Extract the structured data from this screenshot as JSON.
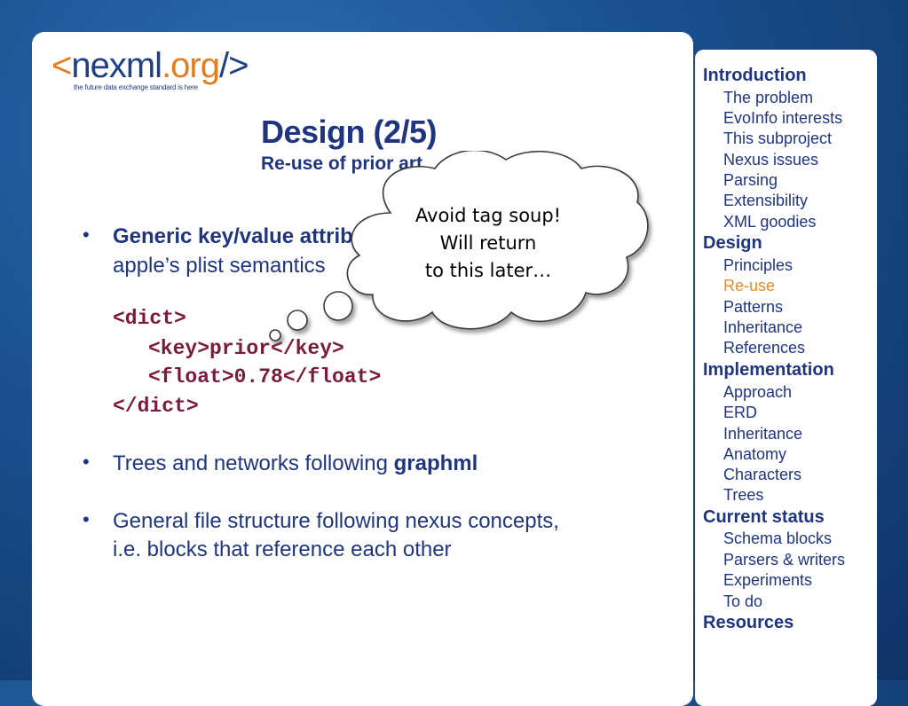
{
  "logo": {
    "open_bracket": "<",
    "name": "nexml",
    "tld": ".org",
    "close_bracket": "/>",
    "tagline": "the future data exchange standard is here"
  },
  "slide": {
    "title": "Design (2/5)",
    "subtitle": "Re-use of prior art"
  },
  "content": {
    "bullet_char": "•",
    "item1": {
      "bold": "Generic key/value attributes",
      "line2": "apple’s plist semantics"
    },
    "code_lines": [
      "<dict>",
      "<key>prior</key>",
      "<float>0.78</float>",
      "</dict>"
    ],
    "item2": {
      "text": "Trees and networks following ",
      "bold": "graphml"
    },
    "item3": {
      "line1": "General file structure following nexus concepts,",
      "line2": "i.e. blocks that reference each other"
    }
  },
  "callout": {
    "lines": [
      "Avoid tag soup!",
      "Will return",
      "to this later…"
    ]
  },
  "sidebar": {
    "active_color": "#e98b22",
    "items": [
      {
        "label": "Introduction",
        "level": "section"
      },
      {
        "label": "The problem",
        "level": "sub"
      },
      {
        "label": "EvoInfo interests",
        "level": "sub"
      },
      {
        "label": "This subproject",
        "level": "sub"
      },
      {
        "label": "Nexus issues",
        "level": "sub"
      },
      {
        "label": "Parsing",
        "level": "sub"
      },
      {
        "label": "Extensibility",
        "level": "sub"
      },
      {
        "label": "XML goodies",
        "level": "sub"
      },
      {
        "label": "Design",
        "level": "section"
      },
      {
        "label": "Principles",
        "level": "sub"
      },
      {
        "label": "Re-use",
        "level": "sub",
        "active": true
      },
      {
        "label": "Patterns",
        "level": "sub"
      },
      {
        "label": "Inheritance",
        "level": "sub"
      },
      {
        "label": "References",
        "level": "sub"
      },
      {
        "label": "Implementation",
        "level": "section"
      },
      {
        "label": "Approach",
        "level": "sub"
      },
      {
        "label": "ERD",
        "level": "sub"
      },
      {
        "label": "Inheritance",
        "level": "sub"
      },
      {
        "label": "Anatomy",
        "level": "sub"
      },
      {
        "label": "Characters",
        "level": "sub"
      },
      {
        "label": "Trees",
        "level": "sub"
      },
      {
        "label": "Current status",
        "level": "section"
      },
      {
        "label": "Schema blocks",
        "level": "sub"
      },
      {
        "label": "Parsers & writers",
        "level": "sub"
      },
      {
        "label": "Experiments",
        "level": "sub"
      },
      {
        "label": "To do",
        "level": "sub"
      },
      {
        "label": "Resources",
        "level": "section"
      }
    ]
  }
}
